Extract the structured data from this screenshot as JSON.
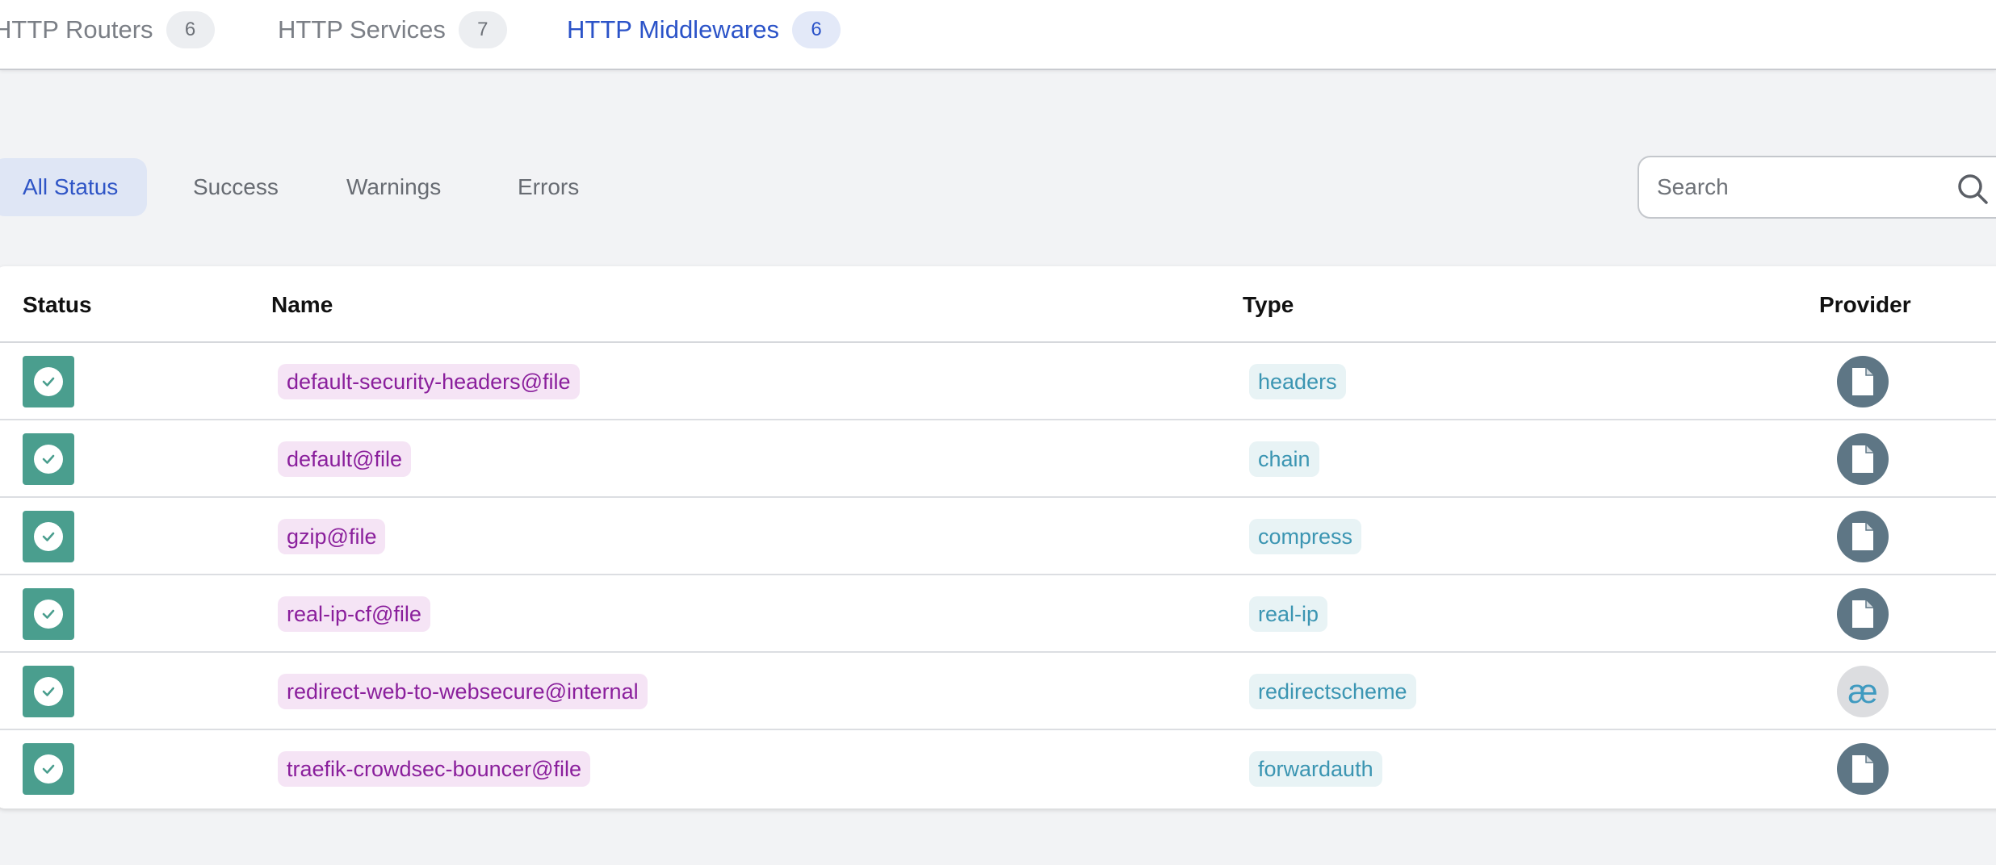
{
  "tabs": [
    {
      "label": "HTTP Routers",
      "count": "6"
    },
    {
      "label": "HTTP Services",
      "count": "7"
    },
    {
      "label": "HTTP Middlewares",
      "count": "6",
      "active": true
    }
  ],
  "filters": {
    "all": "All Status",
    "success": "Success",
    "warnings": "Warnings",
    "errors": "Errors"
  },
  "search": {
    "placeholder": "Search",
    "icon": "search-icon"
  },
  "table": {
    "headers": {
      "status": "Status",
      "name": "Name",
      "type": "Type",
      "provider": "Provider"
    },
    "rows": [
      {
        "name": "default-security-headers@file",
        "type": "headers",
        "provider": "file-icon"
      },
      {
        "name": "default@file",
        "type": "chain",
        "provider": "file-icon"
      },
      {
        "name": "gzip@file",
        "type": "compress",
        "provider": "file-icon"
      },
      {
        "name": "real-ip-cf@file",
        "type": "real-ip",
        "provider": "file-icon"
      },
      {
        "name": "redirect-web-to-websecure@internal",
        "type": "redirectscheme",
        "provider": "internal-icon",
        "provider_glyph": "æ"
      },
      {
        "name": "traefik-crowdsec-bouncer@file",
        "type": "forwardauth",
        "provider": "file-icon"
      }
    ]
  },
  "colors": {
    "accent": "#2b53c8",
    "success": "#4a9e8e",
    "name_text": "#8a1f9c",
    "type_text": "#3b95b2",
    "provider_bg": "#5e7685"
  }
}
